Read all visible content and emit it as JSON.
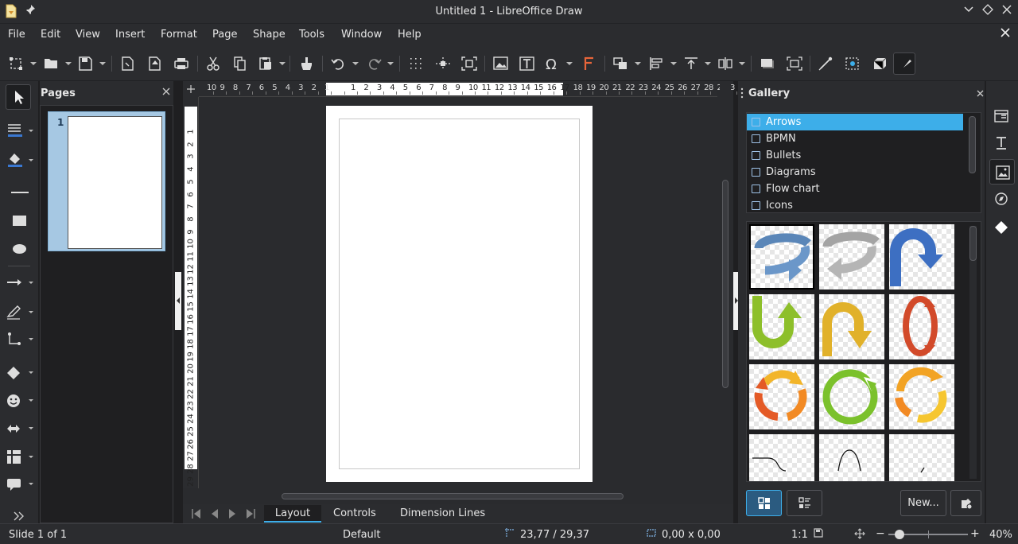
{
  "window": {
    "title": "Untitled 1 - LibreOffice Draw"
  },
  "menu": [
    "File",
    "Edit",
    "View",
    "Insert",
    "Format",
    "Page",
    "Shape",
    "Tools",
    "Window",
    "Help"
  ],
  "pages_panel": {
    "title": "Pages",
    "page_number": "1"
  },
  "gallery": {
    "title": "Gallery",
    "themes": [
      "Arrows",
      "BPMN",
      "Bullets",
      "Diagrams",
      "Flow chart",
      "Icons"
    ],
    "selected_theme": "Arrows",
    "new_button": "New..."
  },
  "ruler": {
    "horizontal": [
      "10",
      "9",
      "8",
      "7",
      "6",
      "5",
      "4",
      "3",
      "2",
      "1",
      "",
      "1",
      "2",
      "3",
      "4",
      "5",
      "6",
      "7",
      "8",
      "9",
      "10",
      "11",
      "12",
      "13",
      "14",
      "15",
      "16",
      "17",
      "18",
      "19",
      "20",
      "21",
      "22",
      "23",
      "24",
      "25",
      "26",
      "27",
      "28",
      "29",
      "3"
    ],
    "vertical": [
      "1",
      "2",
      "3",
      "4",
      "5",
      "6",
      "7",
      "8",
      "9",
      "10",
      "11",
      "12",
      "13",
      "14",
      "15",
      "16",
      "17",
      "18",
      "19",
      "20",
      "21",
      "22",
      "23",
      "24",
      "25",
      "26",
      "27",
      "28",
      "29"
    ]
  },
  "layer_tabs": [
    "Layout",
    "Controls",
    "Dimension Lines"
  ],
  "active_layer_tab": "Layout",
  "status": {
    "slide": "Slide 1 of 1",
    "master": "Default",
    "position": "23,77 / 29,37",
    "size": "0,00 x 0,00",
    "scale": "1:1",
    "zoom": "40%"
  },
  "colors": {
    "accent": "#3daee9",
    "background": "#2b2c2f",
    "selected_tool": "#1e1f21"
  }
}
